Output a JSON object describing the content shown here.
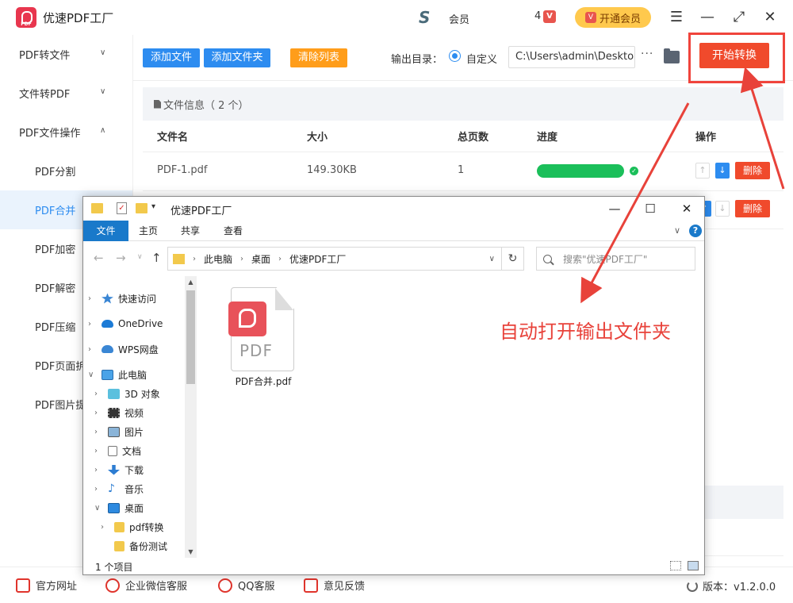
{
  "app": {
    "title": "优速PDF工厂",
    "user_name": "会员",
    "vip_count": "4",
    "vip_button": "开通会员"
  },
  "sidebar": {
    "items": [
      {
        "label": "PDF转文件"
      },
      {
        "label": "文件转PDF"
      },
      {
        "label": "PDF文件操作"
      }
    ],
    "subitems": [
      {
        "label": "PDF分割"
      },
      {
        "label": "PDF合并"
      },
      {
        "label": "PDF加密"
      },
      {
        "label": "PDF解密"
      },
      {
        "label": "PDF压缩"
      },
      {
        "label": "PDF页面拆"
      },
      {
        "label": "PDF图片提"
      }
    ]
  },
  "toolbar": {
    "add_file": "添加文件",
    "add_folder": "添加文件夹",
    "clear_list": "清除列表",
    "output_label": "输出目录：",
    "custom_label": "自定义",
    "path_value": "C:\\Users\\admin\\Desktop",
    "more": "···",
    "start": "开始转换"
  },
  "filelist": {
    "header": "文件信息（ 2 个）",
    "columns": [
      "文件名",
      "大小",
      "总页数",
      "进度",
      "操作"
    ],
    "rows": [
      {
        "name": "PDF-1.pdf",
        "size": "149.30KB",
        "pages": "1",
        "progress": 1.0
      }
    ],
    "delete_label": "删除"
  },
  "footer": {
    "website": "官方网址",
    "wechat": "企业微信客服",
    "qq": "QQ客服",
    "feedback": "意见反馈",
    "version": "版本：v1.2.0.0"
  },
  "explorer": {
    "title": "优速PDF工厂",
    "tabs": [
      "文件",
      "主页",
      "共享",
      "查看"
    ],
    "breadcrumbs": [
      "此电脑",
      "桌面",
      "优速PDF工厂"
    ],
    "search_placeholder": "搜索\"优速PDF工厂\"",
    "nav": [
      {
        "label": "快速访问",
        "level": 0,
        "icon": "star-icon"
      },
      {
        "label": "OneDrive",
        "level": 0,
        "icon": "cloud-icon"
      },
      {
        "label": "WPS网盘",
        "level": 0,
        "icon": "cloud-icon"
      },
      {
        "label": "此电脑",
        "level": 0,
        "icon": "computer-icon"
      },
      {
        "label": "3D 对象",
        "level": 1,
        "icon": "cube-icon"
      },
      {
        "label": "视频",
        "level": 1,
        "icon": "video-icon"
      },
      {
        "label": "图片",
        "level": 1,
        "icon": "image-icon"
      },
      {
        "label": "文档",
        "level": 1,
        "icon": "document-icon"
      },
      {
        "label": "下载",
        "level": 1,
        "icon": "download-icon"
      },
      {
        "label": "音乐",
        "level": 1,
        "icon": "music-icon"
      },
      {
        "label": "桌面",
        "level": 1,
        "icon": "desktop-icon"
      },
      {
        "label": "pdf转换",
        "level": 2,
        "icon": "folder-icon"
      },
      {
        "label": "备份测试",
        "level": 2,
        "icon": "folder-icon"
      }
    ],
    "file_name": "PDF合并.pdf",
    "pdf_text": "PDF",
    "status": "1 个项目"
  },
  "annotation": "自动打开输出文件夹",
  "colors": {
    "accent": "#2d8cf0",
    "danger": "#f04a2c",
    "success": "#1bbf5a",
    "annotation": "#e8423a"
  }
}
